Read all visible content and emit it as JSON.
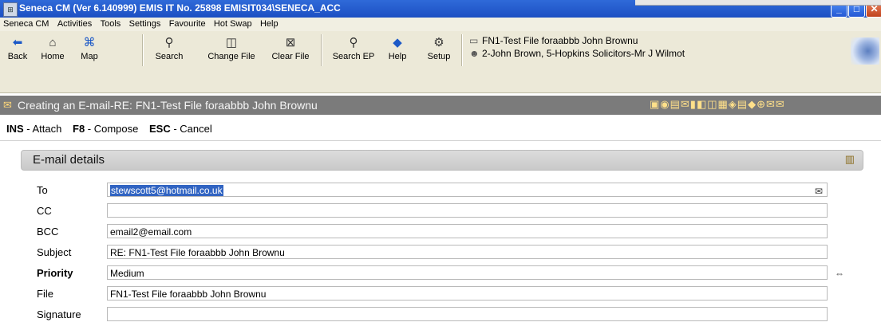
{
  "window": {
    "title": "Seneca CM  (Ver 6.140999)  EMIS IT No. 25898  EMISIT034\\SENECA_ACC",
    "app_icon": "seneca-app-icon",
    "controls": {
      "minimize": "_",
      "maximize": "□",
      "close": "✕"
    }
  },
  "menu": [
    "Seneca CM",
    "Activities",
    "Tools",
    "Settings",
    "Favourite",
    "Hot Swap",
    "Help"
  ],
  "toolbar": {
    "buttons": [
      {
        "label": "Back",
        "icon": "arrow-left-icon",
        "glyph": "⬅"
      },
      {
        "label": "Home",
        "icon": "home-icon",
        "glyph": "⌂"
      },
      {
        "label": "Map",
        "icon": "map-icon",
        "glyph": "⌘"
      },
      {
        "label": "Search",
        "icon": "search-icon",
        "glyph": "⚲"
      },
      {
        "label": "Change File",
        "icon": "change-file-icon",
        "glyph": "◫"
      },
      {
        "label": "Clear File",
        "icon": "clear-file-icon",
        "glyph": "⊠"
      },
      {
        "label": "Search EP",
        "icon": "search-ep-icon",
        "glyph": "⚲"
      },
      {
        "label": "Help",
        "icon": "help-icon",
        "glyph": "◆"
      },
      {
        "label": "Setup",
        "icon": "setup-icon",
        "glyph": "⚙"
      }
    ],
    "file_line": "FN1-Test File foraabbb John Brownu",
    "client_line": "2-John Brown, 5-Hopkins Solicitors-Mr J Wilmot"
  },
  "header": {
    "title": "Creating an E-mail-RE: FN1-Test File foraabbb John Brownu",
    "icon": "envelope-icon",
    "tool_icons": "▣◉▤✉▮◧◫▦◈▤◆⊕✉✉"
  },
  "shortcuts": [
    {
      "key": "INS",
      "action": "Attach"
    },
    {
      "key": "F8",
      "action": "Compose"
    },
    {
      "key": "ESC",
      "action": "Cancel"
    }
  ],
  "section": {
    "title": "E-mail details",
    "icon": "building-icon"
  },
  "form": {
    "to": {
      "label": "To",
      "value": "stewscott5@hotmail.co.uk"
    },
    "cc": {
      "label": "CC",
      "value": ""
    },
    "bcc": {
      "label": "BCC",
      "value": "email2@email.com"
    },
    "subject": {
      "label": "Subject",
      "value": "RE: FN1-Test File foraabbb John Brownu"
    },
    "priority": {
      "label": "Priority",
      "value": "Medium"
    },
    "file": {
      "label": "File",
      "value": "FN1-Test File foraabbb John Brownu"
    },
    "signature": {
      "label": "Signature",
      "value": ""
    }
  }
}
